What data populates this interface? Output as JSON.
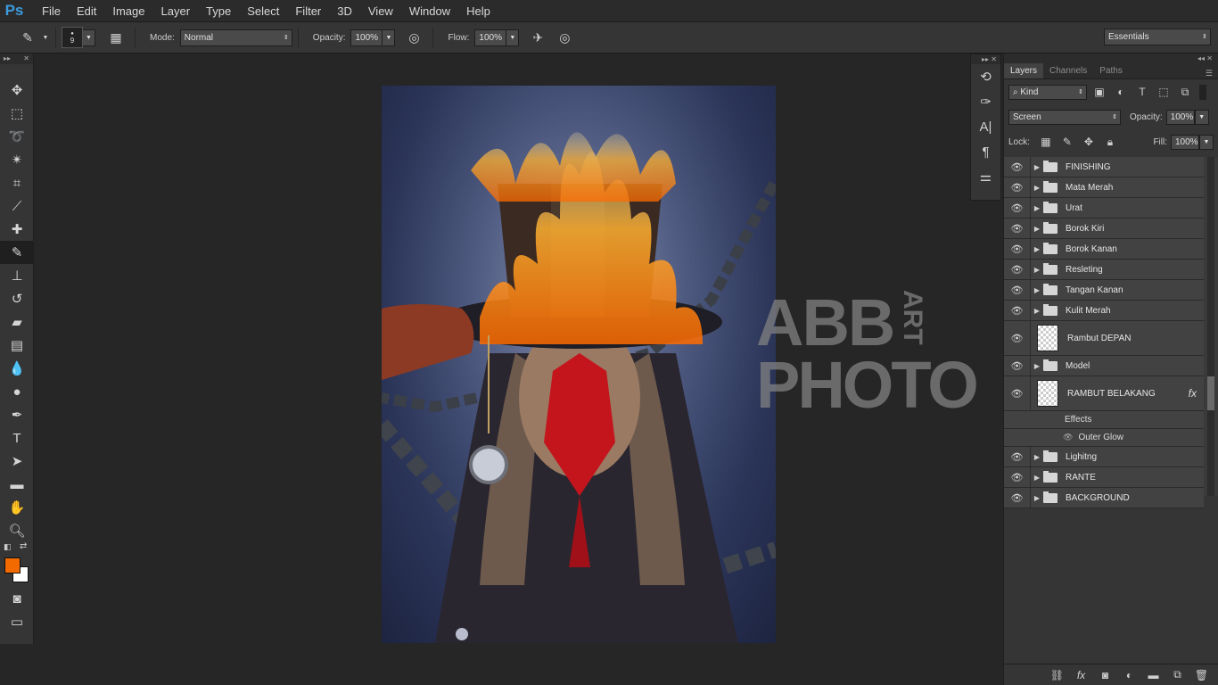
{
  "app": {
    "logo": "Ps"
  },
  "menu": [
    "File",
    "Edit",
    "Image",
    "Layer",
    "Type",
    "Select",
    "Filter",
    "3D",
    "View",
    "Window",
    "Help"
  ],
  "options": {
    "brush_size": "9",
    "mode_label": "Mode:",
    "mode_value": "Normal",
    "opacity_label": "Opacity:",
    "opacity_value": "100%",
    "flow_label": "Flow:",
    "flow_value": "100%",
    "workspace": "Essentials"
  },
  "colors": {
    "foreground": "#f26a00",
    "background": "#ffffff"
  },
  "watermark": {
    "line1": "ABB",
    "line2": "PHOTO",
    "vertical": "ART"
  },
  "panel": {
    "tabs": [
      "Layers",
      "Channels",
      "Paths"
    ],
    "filter_kind": "Kind",
    "blend_mode": "Screen",
    "opacity_label": "Opacity:",
    "opacity_value": "100%",
    "lock_label": "Lock:",
    "fill_label": "Fill:",
    "fill_value": "100%",
    "layers": [
      {
        "name": "FINISHING"
      },
      {
        "name": "Mata Merah"
      },
      {
        "name": "Urat"
      },
      {
        "name": "Borok Kiri"
      },
      {
        "name": "Borok Kanan"
      },
      {
        "name": "Resleting"
      },
      {
        "name": "Tangan Kanan"
      },
      {
        "name": "Kulit Merah"
      },
      {
        "name": "Rambut DEPAN"
      },
      {
        "name": "Model"
      },
      {
        "name": "RAMBUT BELAKANG",
        "fx": "fx",
        "effects_label": "Effects",
        "effect": "Outer Glow"
      },
      {
        "name": "Lighitng"
      },
      {
        "name": "RANTE"
      },
      {
        "name": "BACKGROUND"
      }
    ]
  }
}
